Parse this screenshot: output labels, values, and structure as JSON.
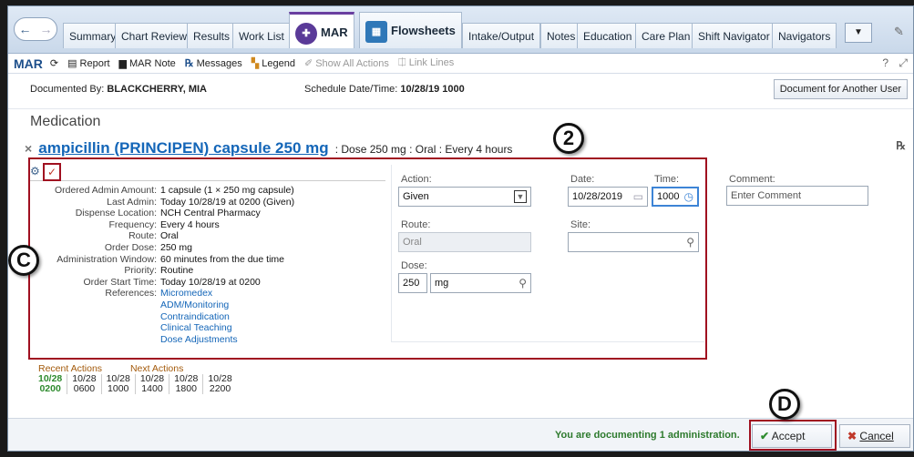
{
  "tabs": [
    {
      "label": "Summary"
    },
    {
      "label": "Chart Review"
    },
    {
      "label": "Results"
    },
    {
      "label": "Work List"
    },
    {
      "label": "MAR"
    },
    {
      "label": "Flowsheets"
    },
    {
      "label": "Intake/Output"
    },
    {
      "label": "Notes"
    },
    {
      "label": "Education"
    },
    {
      "label": "Care Plan"
    },
    {
      "label": "Shift Navigator"
    },
    {
      "label": "Navigators"
    }
  ],
  "toolbar": {
    "title": "MAR",
    "report": "Report",
    "mar_note": "MAR Note",
    "messages": "Messages",
    "legend": "Legend",
    "show_all_actions": "Show All Actions",
    "link_lines": "Link Lines"
  },
  "header": {
    "documented_by_label": "Documented By:",
    "documented_by_value": "BLACKCHERRY, MIA",
    "schedule_label": "Schedule Date/Time:",
    "schedule_value": "10/28/19 1000",
    "document_other_btn": "Document for Another User"
  },
  "section_title": "Medication",
  "medication": {
    "name": "ampicillin (PRINCIPEN) capsule 250 mg",
    "sig": ": Dose 250 mg : Oral : Every 4 hours"
  },
  "details": [
    {
      "label": "Ordered Admin Amount:",
      "value": "1 capsule (1 × 250 mg capsule)"
    },
    {
      "label": "Last Admin:",
      "value": "Today 10/28/19 at 0200  (Given)"
    },
    {
      "label": "Dispense Location:",
      "value": "NCH Central Pharmacy"
    },
    {
      "label": "Frequency:",
      "value": "Every 4 hours"
    },
    {
      "label": "Route:",
      "value": "Oral"
    },
    {
      "label": "Order Dose:",
      "value": "250 mg"
    },
    {
      "label": "Administration Window:",
      "value": "60 minutes from the due time"
    },
    {
      "label": "Priority:",
      "value": "Routine"
    },
    {
      "label": "Order Start Time:",
      "value": "Today 10/28/19 at 0200"
    }
  ],
  "references": {
    "label": "References:",
    "links": [
      "Micromedex",
      "ADM/Monitoring",
      "Contraindication",
      "Clinical Teaching",
      "Dose Adjustments"
    ]
  },
  "form": {
    "action_label": "Action:",
    "action_value": "Given",
    "date_label": "Date:",
    "date_value": "10/28/2019",
    "time_label": "Time:",
    "time_value": "1000",
    "comment_label": "Comment:",
    "comment_placeholder": "Enter Comment",
    "route_label": "Route:",
    "route_value": "Oral",
    "site_label": "Site:",
    "dose_label": "Dose:",
    "dose_value": "250",
    "dose_unit": "mg"
  },
  "actions": {
    "recent_label": "Recent Actions",
    "next_label": "Next Actions",
    "columns": [
      {
        "date": "10/28",
        "time": "0200",
        "recent": true
      },
      {
        "date": "10/28",
        "time": "0600",
        "recent": false
      },
      {
        "date": "10/28",
        "time": "1000",
        "recent": false
      },
      {
        "date": "10/28",
        "time": "1400",
        "recent": false
      },
      {
        "date": "10/28",
        "time": "1800",
        "recent": false
      },
      {
        "date": "10/28",
        "time": "2200",
        "recent": false
      }
    ]
  },
  "footer": {
    "message": "You are documenting 1 administration.",
    "accept": "Accept",
    "cancel": "Cancel"
  },
  "callouts": {
    "two": "2",
    "c": "C",
    "d": "D"
  },
  "colors": {
    "accent": "#1466b8",
    "highlight": "#a01020",
    "recent": "#2e8b2e"
  }
}
